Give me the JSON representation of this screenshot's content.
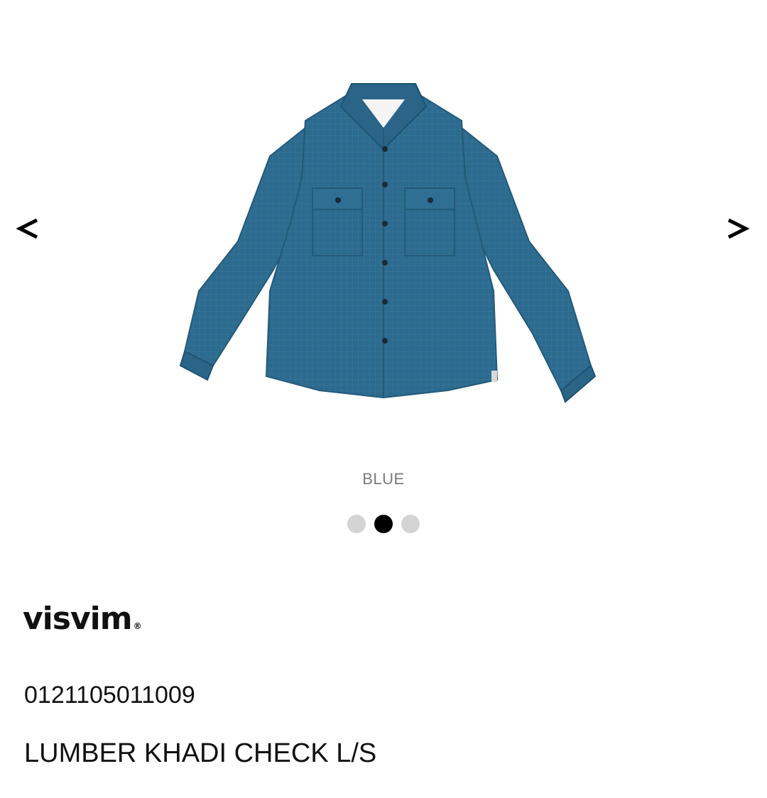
{
  "gallery": {
    "prev_icon": "chevron-left-icon",
    "next_icon": "chevron-right-icon",
    "image_alt_subject": "blue long sleeve check shirt",
    "color_label": "BLUE",
    "dots": [
      {
        "active": false
      },
      {
        "active": true
      },
      {
        "active": false
      }
    ],
    "shirt_color": "#2c6a8e"
  },
  "brand": {
    "name": "visvim",
    "registered_mark": "®"
  },
  "product": {
    "sku": "0121105011009",
    "title": "LUMBER KHADI CHECK L/S"
  }
}
